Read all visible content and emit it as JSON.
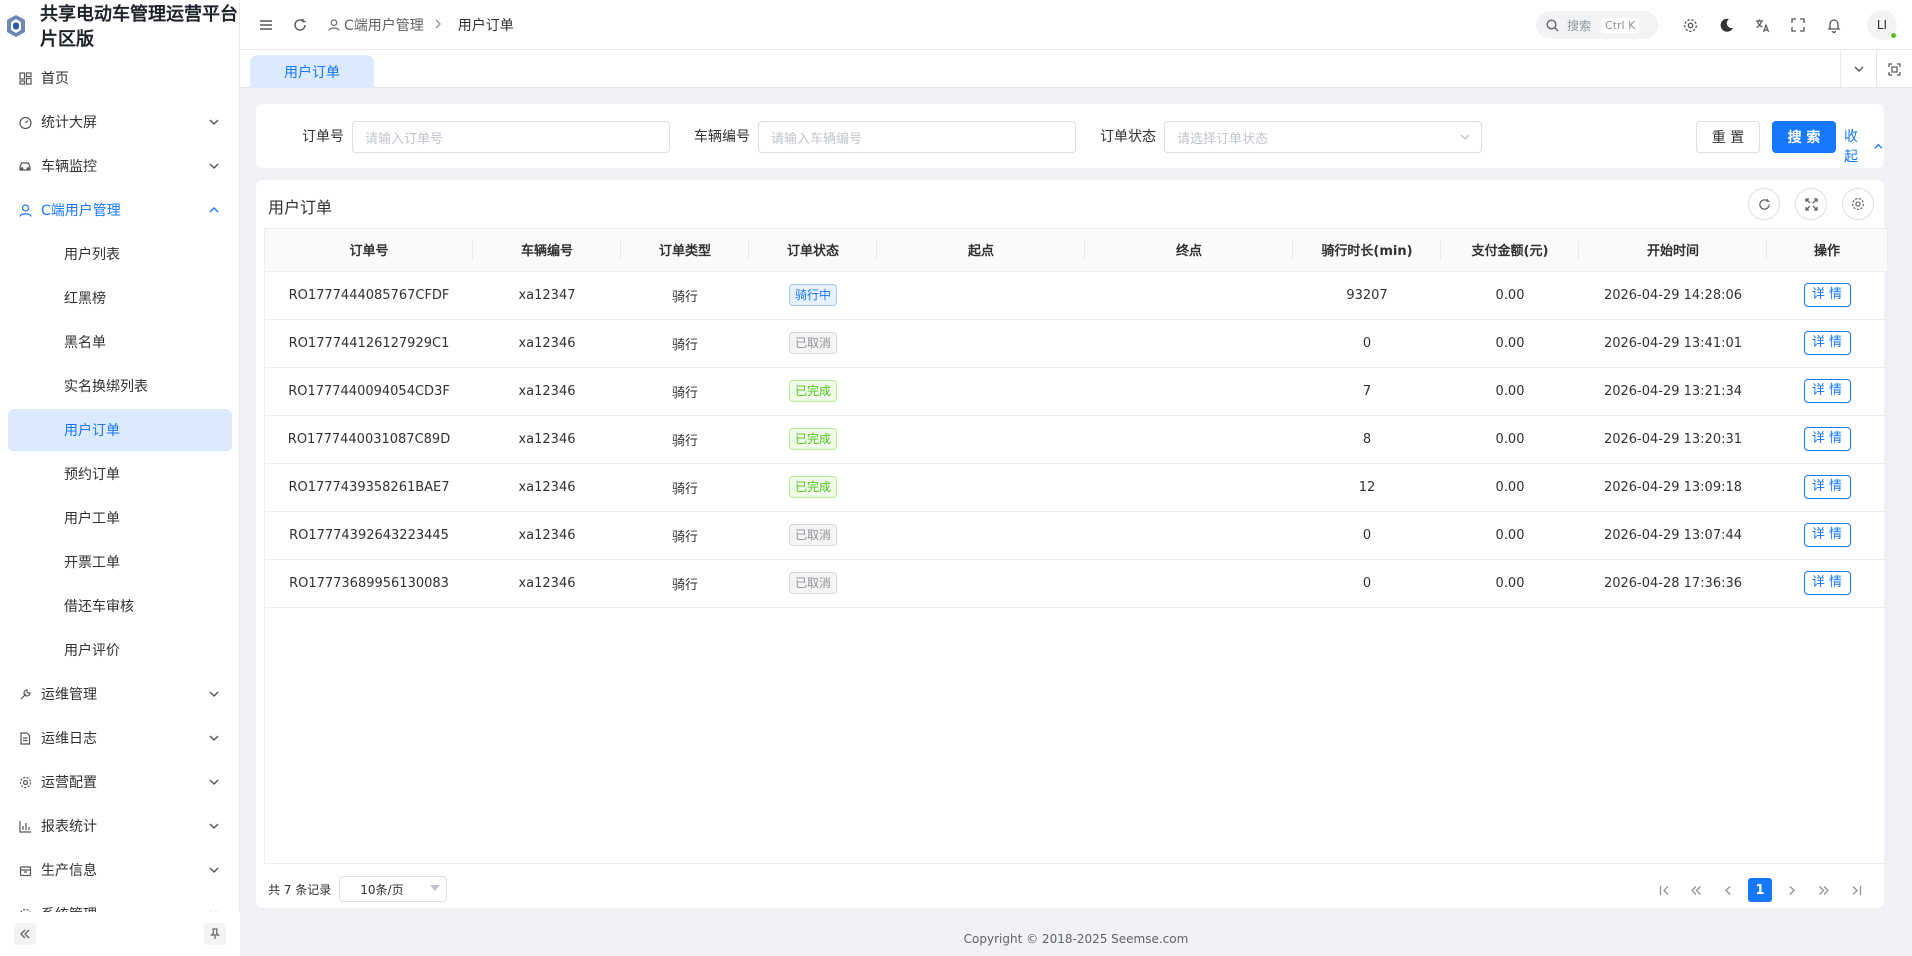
{
  "brand": {
    "title_line1": "共享电动车管理运营平台",
    "title_line2": "片区版"
  },
  "sidebar": {
    "items": [
      {
        "label": "首页",
        "icon": "dashboard-icon",
        "expandable": false
      },
      {
        "label": "统计大屏",
        "icon": "gauge-icon",
        "expandable": true
      },
      {
        "label": "车辆监控",
        "icon": "car-icon",
        "expandable": true
      },
      {
        "label": "C端用户管理",
        "icon": "user-icon",
        "expandable": true,
        "expanded": true
      }
    ],
    "sub_items": [
      "用户列表",
      "红黑榜",
      "黑名单",
      "实名换绑列表",
      "用户订单",
      "预约订单",
      "用户工单",
      "开票工单",
      "借还车审核",
      "用户评价"
    ],
    "active_sub": "用户订单",
    "items_after": [
      {
        "label": "运维管理",
        "icon": "wrench-icon"
      },
      {
        "label": "运维日志",
        "icon": "file-icon"
      },
      {
        "label": "运营配置",
        "icon": "gear-icon"
      },
      {
        "label": "报表统计",
        "icon": "bar-chart-icon"
      },
      {
        "label": "生产信息",
        "icon": "box-icon"
      },
      {
        "label": "系统管理",
        "icon": "settings-icon"
      }
    ]
  },
  "header": {
    "breadcrumb": [
      "C端用户管理",
      "用户订单"
    ],
    "search_placeholder": "搜索",
    "search_shortcut": "Ctrl K",
    "avatar_text": "LI"
  },
  "tabs": [
    {
      "label": "用户订单",
      "active": true
    }
  ],
  "filters": {
    "order_no_label": "订单号",
    "order_no_placeholder": "请输入订单号",
    "vehicle_label": "车辆编号",
    "vehicle_placeholder": "请输入车辆编号",
    "status_label": "订单状态",
    "status_placeholder": "请选择订单状态",
    "reset_label": "重 置",
    "search_label": "搜 索",
    "collapse_label": "收起"
  },
  "table": {
    "title": "用户订单",
    "columns": [
      "订单号",
      "车辆编号",
      "订单类型",
      "订单状态",
      "起点",
      "终点",
      "骑行时长(min)",
      "支付金额(元)",
      "开始时间",
      "操作"
    ],
    "rows": [
      {
        "order_no": "RO1777444085767CFDF",
        "vehicle": "xa12347",
        "type": "骑行",
        "status": "骑行中",
        "status_kind": "ride",
        "start": "",
        "end": "",
        "duration": "93207",
        "amount": "0.00",
        "start_time": "2026-04-29 14:28:06",
        "action": "详 情"
      },
      {
        "order_no": "RO177744126127929C1",
        "vehicle": "xa12346",
        "type": "骑行",
        "status": "已取消",
        "status_kind": "cancel",
        "start": "",
        "end": "",
        "duration": "0",
        "amount": "0.00",
        "start_time": "2026-04-29 13:41:01",
        "action": "详 情"
      },
      {
        "order_no": "RO1777440094054CD3F",
        "vehicle": "xa12346",
        "type": "骑行",
        "status": "已完成",
        "status_kind": "done",
        "start": "",
        "end": "",
        "duration": "7",
        "amount": "0.00",
        "start_time": "2026-04-29 13:21:34",
        "action": "详 情"
      },
      {
        "order_no": "RO1777440031087C89D",
        "vehicle": "xa12346",
        "type": "骑行",
        "status": "已完成",
        "status_kind": "done",
        "start": "",
        "end": "",
        "duration": "8",
        "amount": "0.00",
        "start_time": "2026-04-29 13:20:31",
        "action": "详 情"
      },
      {
        "order_no": "RO1777439358261BAE7",
        "vehicle": "xa12346",
        "type": "骑行",
        "status": "已完成",
        "status_kind": "done",
        "start": "",
        "end": "",
        "duration": "12",
        "amount": "0.00",
        "start_time": "2026-04-29 13:09:18",
        "action": "详 情"
      },
      {
        "order_no": "RO17774392643223445",
        "vehicle": "xa12346",
        "type": "骑行",
        "status": "已取消",
        "status_kind": "cancel",
        "start": "",
        "end": "",
        "duration": "0",
        "amount": "0.00",
        "start_time": "2026-04-29 13:07:44",
        "action": "详 情"
      },
      {
        "order_no": "RO17773689956130083",
        "vehicle": "xa12346",
        "type": "骑行",
        "status": "已取消",
        "status_kind": "cancel",
        "start": "",
        "end": "",
        "duration": "0",
        "amount": "0.00",
        "start_time": "2026-04-28 17:36:36",
        "action": "详 情"
      }
    ]
  },
  "pagination": {
    "total_text": "共 7 条记录",
    "page_size": "10条/页",
    "current_page": "1"
  },
  "footer": {
    "copyright": "Copyright © 2018-2025 Seemse.com"
  },
  "colors": {
    "primary": "#1677ff",
    "success": "#52c41a",
    "muted": "#909399"
  }
}
